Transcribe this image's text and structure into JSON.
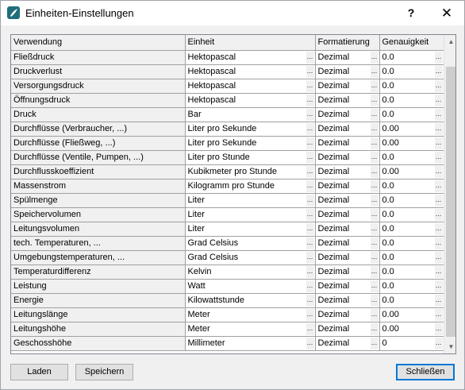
{
  "window": {
    "title": "Einheiten-Einstellungen",
    "help_label": "?",
    "close_label": "✕"
  },
  "grid": {
    "columns": [
      "Verwendung",
      "Einheit",
      "Formatierung",
      "Genauigkeit"
    ],
    "cell_button_label": "...",
    "rows": [
      {
        "use": "Fließdruck",
        "unit": "Hektopascal",
        "format": "Dezimal",
        "precision": "0.0"
      },
      {
        "use": "Druckverlust",
        "unit": "Hektopascal",
        "format": "Dezimal",
        "precision": "0.0"
      },
      {
        "use": "Versorgungsdruck",
        "unit": "Hektopascal",
        "format": "Dezimal",
        "precision": "0.0"
      },
      {
        "use": "Öffnungsdruck",
        "unit": "Hektopascal",
        "format": "Dezimal",
        "precision": "0.0"
      },
      {
        "use": "Druck",
        "unit": "Bar",
        "format": "Dezimal",
        "precision": "0.0"
      },
      {
        "use": "Durchflüsse (Verbraucher, ...)",
        "unit": "Liter pro Sekunde",
        "format": "Dezimal",
        "precision": "0.00"
      },
      {
        "use": "Durchflüsse (Fließweg, ...)",
        "unit": "Liter pro Sekunde",
        "format": "Dezimal",
        "precision": "0.00"
      },
      {
        "use": "Durchflüsse (Ventile, Pumpen, ...)",
        "unit": "Liter pro Stunde",
        "format": "Dezimal",
        "precision": "0.0"
      },
      {
        "use": "Durchflusskoeffizient",
        "unit": "Kubikmeter pro Stunde",
        "format": "Dezimal",
        "precision": "0.00"
      },
      {
        "use": "Massenstrom",
        "unit": "Kilogramm pro Stunde",
        "format": "Dezimal",
        "precision": "0.0"
      },
      {
        "use": "Spülmenge",
        "unit": "Liter",
        "format": "Dezimal",
        "precision": "0.0"
      },
      {
        "use": "Speichervolumen",
        "unit": "Liter",
        "format": "Dezimal",
        "precision": "0.0"
      },
      {
        "use": "Leitungsvolumen",
        "unit": "Liter",
        "format": "Dezimal",
        "precision": "0.0"
      },
      {
        "use": "tech. Temperaturen, ...",
        "unit": "Grad Celsius",
        "format": "Dezimal",
        "precision": "0.0"
      },
      {
        "use": "Umgebungstemperaturen, ...",
        "unit": "Grad Celsius",
        "format": "Dezimal",
        "precision": "0.0"
      },
      {
        "use": "Temperaturdifferenz",
        "unit": "Kelvin",
        "format": "Dezimal",
        "precision": "0.0"
      },
      {
        "use": "Leistung",
        "unit": "Watt",
        "format": "Dezimal",
        "precision": "0.0"
      },
      {
        "use": "Energie",
        "unit": "Kilowattstunde",
        "format": "Dezimal",
        "precision": "0.0"
      },
      {
        "use": "Leitungslänge",
        "unit": "Meter",
        "format": "Dezimal",
        "precision": "0.00"
      },
      {
        "use": "Leitungshöhe",
        "unit": "Meter",
        "format": "Dezimal",
        "precision": "0.00"
      },
      {
        "use": "Geschosshöhe",
        "unit": "Millimeter",
        "format": "Dezimal",
        "precision": "0"
      }
    ]
  },
  "buttons": {
    "load": "Laden",
    "save": "Speichern",
    "close": "Schließen"
  },
  "icons": {
    "app": "app-logo-icon",
    "scroll_up": "chevron-up-icon",
    "scroll_down": "chevron-down-icon"
  },
  "colors": {
    "accent": "#0078d7",
    "app_icon": "#1f6f7a"
  }
}
